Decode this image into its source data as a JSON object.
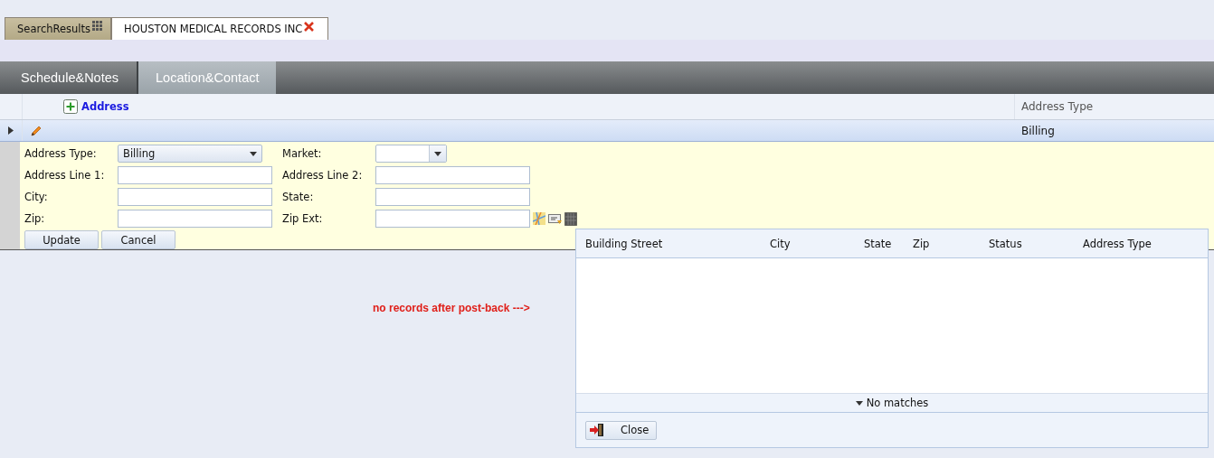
{
  "doc_tabs": [
    {
      "label": "SearchResults",
      "kind": "grid",
      "selected": false
    },
    {
      "label": "HOUSTON MEDICAL RECORDS INC",
      "kind": "close",
      "selected": true
    }
  ],
  "section_tabs": [
    {
      "label": "Schedule&Notes",
      "selected": false
    },
    {
      "label": "Location&Contact",
      "selected": true
    }
  ],
  "grid": {
    "add_label": "Address",
    "column_2": "Address Type",
    "rows": [
      {
        "expanded": false,
        "address_type": "Billing"
      }
    ]
  },
  "form": {
    "fields": [
      {
        "label": "Address Type:",
        "kind": "select",
        "value": "Billing"
      },
      {
        "label": "Market:",
        "kind": "select"
      },
      {
        "label": "Address Line 1:",
        "kind": "text"
      },
      {
        "label": "Address Line 2:",
        "kind": "text"
      },
      {
        "label": "City:",
        "kind": "text"
      },
      {
        "label": "State:",
        "kind": "text"
      },
      {
        "label": "Zip:",
        "kind": "text"
      },
      {
        "label": "Zip Ext:",
        "kind": "text"
      }
    ],
    "buttons": [
      "Update",
      "Cancel"
    ]
  },
  "note": "no records after post-back --->",
  "popup": {
    "columns": [
      "Building Street",
      "City",
      "State",
      "Zip",
      "Status",
      "Address Type"
    ],
    "footer": "No matches",
    "close_label": "Close"
  }
}
